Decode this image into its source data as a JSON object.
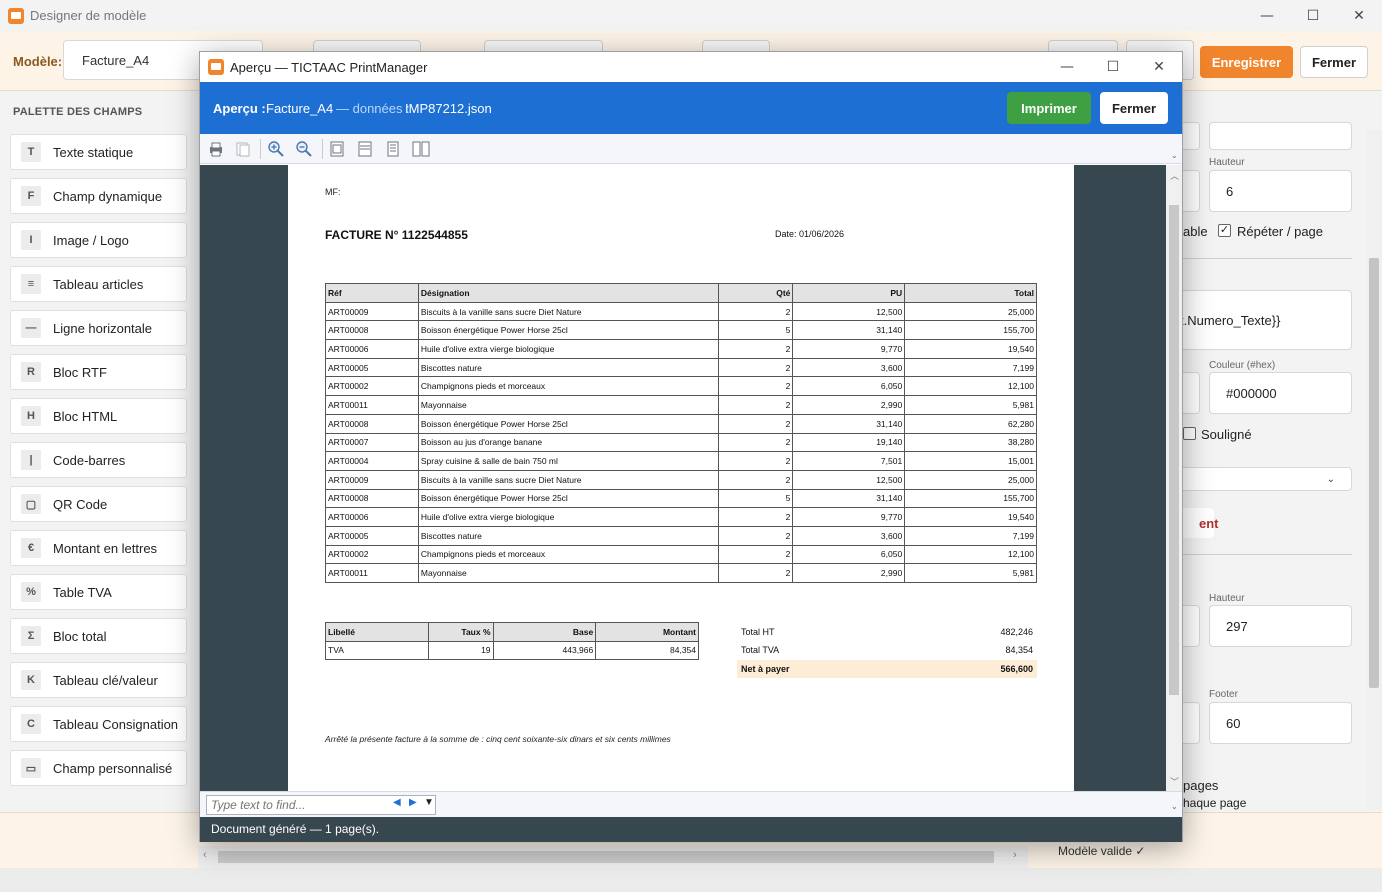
{
  "main_window": {
    "title": "Designer de modèle",
    "controls": {
      "minimize": "—",
      "maximize": "☐",
      "close": "✕"
    }
  },
  "toolbar": {
    "model_label": "Modèle:",
    "model_value": "Facture_A4",
    "save_label": "Enregistrer",
    "close_label": "Fermer"
  },
  "palette": {
    "title": "PALETTE DES CHAMPS",
    "items": [
      {
        "badge": "T",
        "label": "Texte statique"
      },
      {
        "badge": "F",
        "label": "Champ dynamique"
      },
      {
        "badge": "I",
        "label": "Image / Logo"
      },
      {
        "badge": "≡",
        "label": "Tableau articles"
      },
      {
        "badge": "—",
        "label": "Ligne horizontale"
      },
      {
        "badge": "R",
        "label": "Bloc RTF"
      },
      {
        "badge": "H",
        "label": "Bloc HTML"
      },
      {
        "badge": "|",
        "label": "Code-barres"
      },
      {
        "badge": "▢",
        "label": "QR Code"
      },
      {
        "badge": "€",
        "label": "Montant en lettres"
      },
      {
        "badge": "%",
        "label": "Table TVA"
      },
      {
        "badge": "Σ",
        "label": "Bloc total"
      },
      {
        "badge": "K",
        "label": "Tableau clé/valeur"
      },
      {
        "badge": "C",
        "label": "Tableau Consignation"
      },
      {
        "badge": "▭",
        "label": "Champ personnalisé"
      }
    ]
  },
  "properties": {
    "height_label": "Hauteur",
    "height_value": "6",
    "table_fragment": "able",
    "repeat_label": "Répéter / page",
    "expression_fragment": "t.Numero_Texte}}",
    "color_label": "Couleur (#hex)",
    "color_value": "#000000",
    "underline_label": "Souligné",
    "red_fragment": "ent",
    "page_height_label": "Hauteur",
    "page_height_value": "297",
    "paren_fragment": ")",
    "footer_label": "Footer",
    "footer_value": "60",
    "pages_fragment": "pages",
    "each_page_fragment": "chaque page"
  },
  "status": {
    "main": "Modèle valide ✓"
  },
  "dialog": {
    "title": "Aperçu — TICTAAC PrintManager",
    "header_label": "Aperçu :",
    "header_model": "Facture_A4",
    "header_sep": "— données :",
    "header_file": "IMP87212.json",
    "print_label": "Imprimer",
    "close_label": "Fermer",
    "find_placeholder": "Type text to find...",
    "status": "Document généré — 1 page(s)."
  },
  "invoice": {
    "mf": "MF:",
    "title": "FACTURE N° 1122544855",
    "date": "Date: 01/06/2026",
    "columns": [
      "Réf",
      "Désignation",
      "Qté",
      "PU",
      "Total"
    ],
    "rows": [
      [
        "ART00009",
        "Biscuits à la vanille sans sucre Diet Nature",
        "2",
        "12,500",
        "25,000"
      ],
      [
        "ART00008",
        "Boisson énergétique Power Horse 25cl",
        "5",
        "31,140",
        "155,700"
      ],
      [
        "ART00006",
        "Huile d'olive extra vierge biologique",
        "2",
        "9,770",
        "19,540"
      ],
      [
        "ART00005",
        "Biscottes nature",
        "2",
        "3,600",
        "7,199"
      ],
      [
        "ART00002",
        "Champignons pieds et morceaux",
        "2",
        "6,050",
        "12,100"
      ],
      [
        "ART00011",
        "Mayonnaise",
        "2",
        "2,990",
        "5,981"
      ],
      [
        "ART00008",
        "Boisson énergétique Power Horse 25cl",
        "2",
        "31,140",
        "62,280"
      ],
      [
        "ART00007",
        "Boisson au jus d'orange banane",
        "2",
        "19,140",
        "38,280"
      ],
      [
        "ART00004",
        "Spray cuisine & salle de bain 750 ml",
        "2",
        "7,501",
        "15,001"
      ],
      [
        "ART00009",
        "Biscuits à la vanille sans sucre Diet Nature",
        "2",
        "12,500",
        "25,000"
      ],
      [
        "ART00008",
        "Boisson énergétique Power Horse 25cl",
        "5",
        "31,140",
        "155,700"
      ],
      [
        "ART00006",
        "Huile d'olive extra vierge biologique",
        "2",
        "9,770",
        "19,540"
      ],
      [
        "ART00005",
        "Biscottes nature",
        "2",
        "3,600",
        "7,199"
      ],
      [
        "ART00002",
        "Champignons pieds et morceaux",
        "2",
        "6,050",
        "12,100"
      ],
      [
        "ART00011",
        "Mayonnaise",
        "2",
        "2,990",
        "5,981"
      ]
    ],
    "tva_columns": [
      "Libellé",
      "Taux %",
      "Base",
      "Montant"
    ],
    "tva_rows": [
      [
        "TVA",
        "19",
        "443,966",
        "84,354"
      ]
    ],
    "totals": [
      {
        "label": "Total HT",
        "value": "482,246"
      },
      {
        "label": "Total TVA",
        "value": "84,354"
      },
      {
        "label": "Net à payer",
        "value": "566,600"
      }
    ],
    "amount_words": "Arrêté la présente facture à la somme de : cinq cent soixante-six dinars et six cents millimes"
  },
  "icons": [
    "print-icon",
    "copy-icon",
    "zoom-in-icon",
    "zoom-out-icon",
    "fit-page-icon",
    "fit-width-icon",
    "single-page-icon",
    "two-pages-icon"
  ],
  "colors": {
    "accent": "#f0852d",
    "header_blue": "#1e6fd4",
    "print_green": "#3ea043",
    "viewer_bg": "#37474f"
  }
}
